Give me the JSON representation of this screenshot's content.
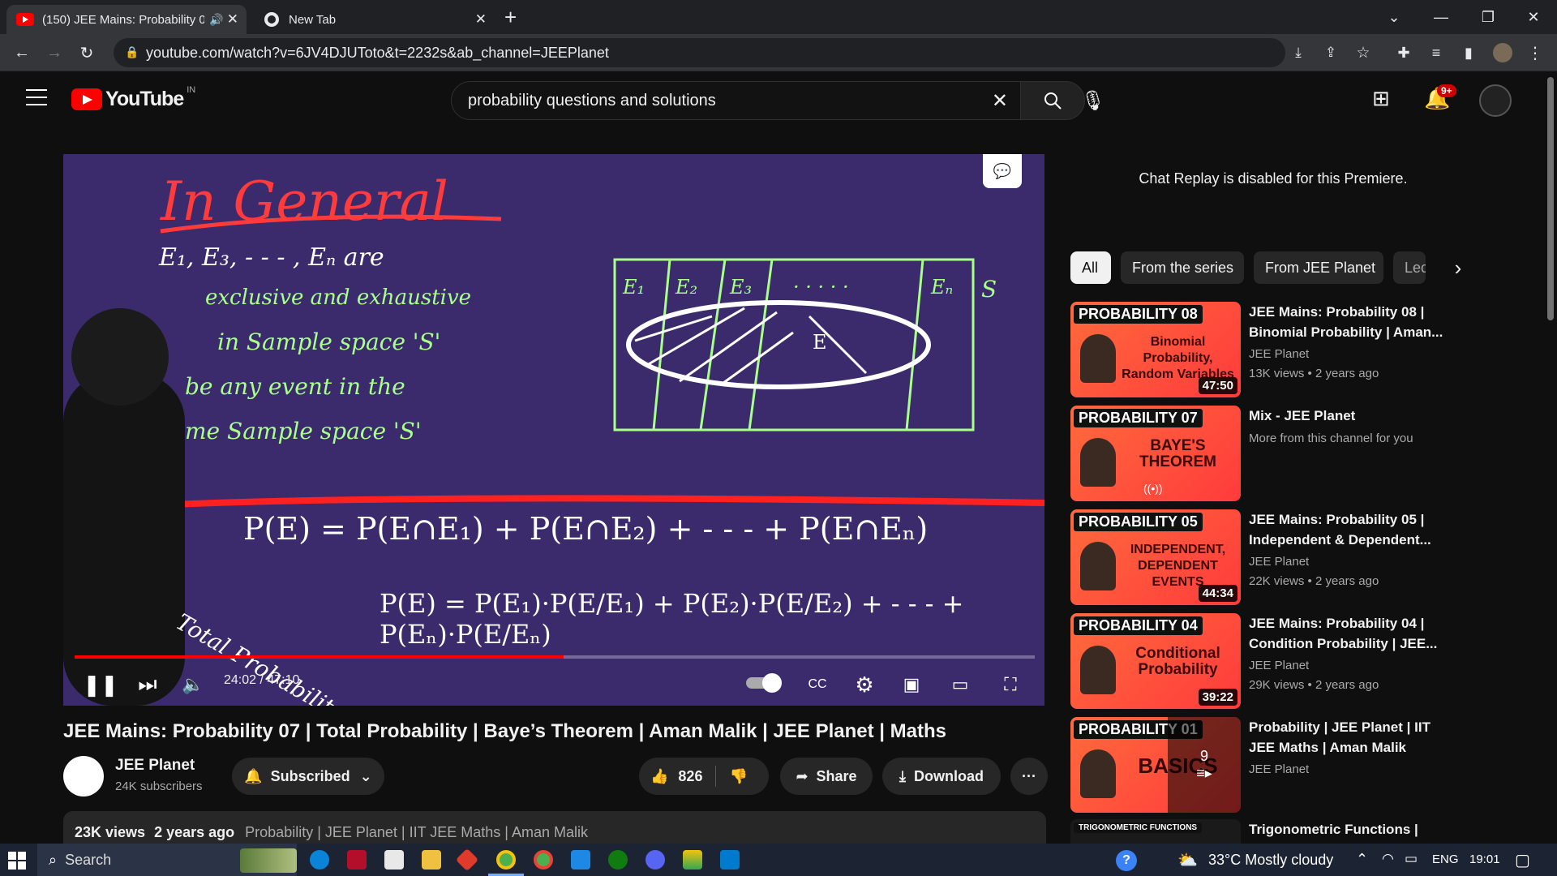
{
  "browser": {
    "tabs": [
      {
        "title": "(150) JEE Mains: Probability 0",
        "active": true
      },
      {
        "title": "New Tab",
        "active": false
      }
    ],
    "url": "youtube.com/watch?v=6JV4DJUToto&t=2232s&ab_channel=JEEPlanet"
  },
  "youtube": {
    "logo": "YouTube",
    "region": "IN",
    "search_value": "probability questions and solutions",
    "notif_count": "9+"
  },
  "player": {
    "time": "24:02 / 47:10",
    "progress": 0.5096
  },
  "board": {
    "heading": "In General",
    "line1": "E₁, E₃, - - - , Eₙ   are",
    "line2": "exclusive  and exhaustive",
    "line3": "in   Sample space 'S'",
    "line4": "be  any  event  in  the",
    "line5": "me  Sample space 'S'",
    "s_label": "S",
    "cells": [
      "E₁",
      "E₂",
      "E₃",
      "· · · · ·",
      "Eₙ"
    ],
    "e_label": "E",
    "formula1": "P(E) = P(E∩E₁) + P(E∩E₂) + - - -   + P(E∩Eₙ)",
    "formula2": "P(E) = P(E₁)·P(E/E₁) + P(E₂)·P(E/E₂) + - - - + P(Eₙ)·P(E/Eₙ)",
    "note": "Total Probability"
  },
  "video": {
    "title": "JEE Mains: Probability 07 | Total Probability | Baye’s Theorem | Aman Malik | JEE Planet | Maths",
    "channel": "JEE Planet",
    "subscribers": "24K subscribers",
    "subscribed_label": "Subscribed",
    "likes": "826",
    "share_label": "Share",
    "download_label": "Download",
    "views": "23K views",
    "age": "2 years ago",
    "tags": "Probability | JEE Planet | IIT JEE Maths | Aman Malik"
  },
  "sidebar": {
    "chat_notice": "Chat Replay is disabled for this Premiere.",
    "chips": [
      "All",
      "From the series",
      "From JEE Planet",
      "Lec"
    ],
    "recommendations": [
      {
        "badge": "PROBABILITY 08",
        "thumb_text": "Binomial Probability, Random Variables",
        "duration": "47:50",
        "title": "JEE Mains: Probability 08 | Binomial Probability | Aman...",
        "channel": "JEE Planet",
        "meta": "13K views  •  2 years ago"
      },
      {
        "badge": "PROBABILITY 07",
        "thumb_text": "BAYE'S THEOREM",
        "duration": "",
        "title": "Mix - JEE Planet",
        "channel": "More from this channel for you",
        "meta": ""
      },
      {
        "badge": "PROBABILITY 05",
        "thumb_text": "INDEPENDENT, DEPENDENT EVENTS",
        "duration": "44:34",
        "title": "JEE Mains: Probability 05 | Independent & Dependent...",
        "channel": "JEE Planet",
        "meta": "22K views  •  2 years ago"
      },
      {
        "badge": "PROBABILITY 04",
        "thumb_text": "Conditional Probability",
        "duration": "39:22",
        "title": "JEE Mains: Probability 04 | Condition Probability | JEE...",
        "channel": "JEE Planet",
        "meta": "29K views  •  2 years ago"
      },
      {
        "badge": "PROBABILITY 01",
        "thumb_text": "BASICS",
        "duration": "9",
        "title": "Probability | JEE Planet | IIT JEE Maths | Aman Malik",
        "channel": "JEE Planet",
        "meta": ""
      },
      {
        "badge": "TRIGONOMETRIC FUNCTIONS",
        "thumb_text": "",
        "duration": "",
        "title": "Trigonometric Functions |",
        "channel": "",
        "meta": ""
      }
    ]
  },
  "taskbar": {
    "search_placeholder": "Search",
    "weather": "33°C  Mostly cloudy",
    "lang": "ENG",
    "time": "19:01"
  }
}
